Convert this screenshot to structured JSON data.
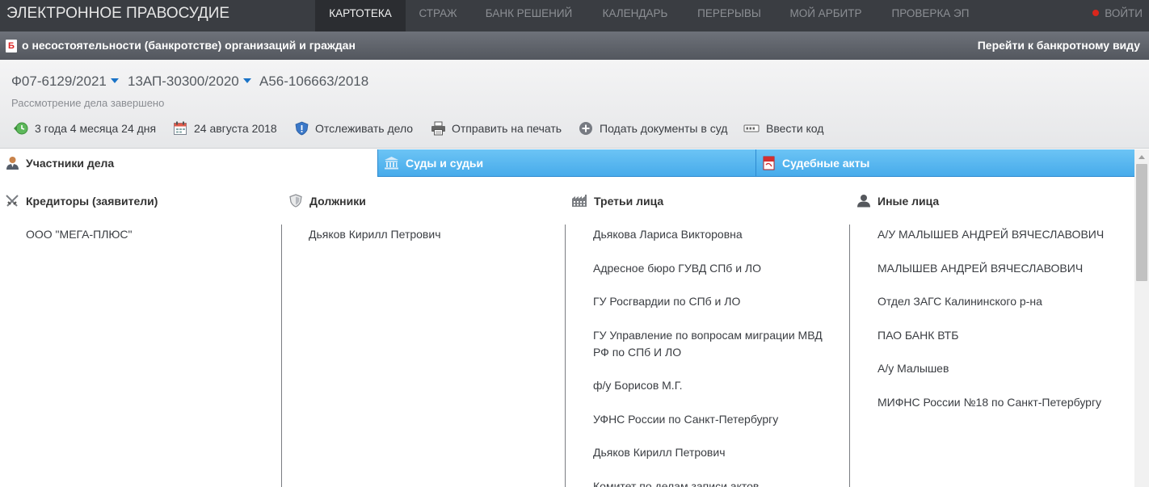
{
  "topnav": {
    "brand": "ЭЛЕКТРОННОЕ ПРАВОСУДИЕ",
    "items": [
      "КАРТОТЕКА",
      "СТРАЖ",
      "БАНК РЕШЕНИЙ",
      "КАЛЕНДАРЬ",
      "ПЕРЕРЫВЫ",
      "МОЙ АРБИТР",
      "ПРОВЕРКА ЭП"
    ],
    "active_item": "КАРТОТЕКА",
    "login": "ВОЙТИ"
  },
  "category_bar": {
    "icon": "bankruptcy-doc-icon",
    "title": "о несостоятельности (банкротстве) организаций и граждан",
    "switch_link": "Перейти к банкротному виду"
  },
  "case": {
    "numbers": [
      "Ф07-6129/2021",
      "13АП-30300/2020",
      "А56-106663/2018"
    ],
    "status": "Рассмотрение дела завершено",
    "actions": [
      {
        "icon": "clock-back-icon",
        "label": "3 года 4 месяца 24 дня"
      },
      {
        "icon": "calendar-icon",
        "label": "24 августа 2018"
      },
      {
        "icon": "shield-icon",
        "label": "Отслеживать дело"
      },
      {
        "icon": "printer-icon",
        "label": "Отправить на печать"
      },
      {
        "icon": "plus-circle-icon",
        "label": "Подать документы в суд"
      },
      {
        "icon": "code-input-icon",
        "label": "Ввести код"
      }
    ]
  },
  "tabs": [
    {
      "icon": "person-icon",
      "label": "Участники дела",
      "active": true
    },
    {
      "icon": "courthouse-icon",
      "label": "Суды и судьи",
      "active": false
    },
    {
      "icon": "pdf-icon",
      "label": "Судебные акты",
      "active": false
    }
  ],
  "columns": [
    {
      "icon": "crossed-swords-icon",
      "title": "Кредиторы (заявители)",
      "items": [
        "ООО \"МЕГА-ПЛЮС\""
      ]
    },
    {
      "icon": "shield-icon",
      "title": "Должники",
      "items": [
        "Дьяков Кирилл Петрович"
      ]
    },
    {
      "icon": "factory-icon",
      "title": "Третьи лица",
      "items": [
        "Дьякова Лариса Викторовна",
        "Адресное бюро ГУВД СПб и ЛО",
        "ГУ Росгвардии по СПб и ЛО",
        "ГУ Управление по вопросам миграции МВД РФ по СПб И ЛО",
        "ф/у Борисов М.Г.",
        "УФНС России по Санкт-Петербургу",
        "Дьяков Кирилл Петрович",
        "Комитет по делам записи актов"
      ]
    },
    {
      "icon": "person-icon",
      "title": "Иные лица",
      "items": [
        "А/У МАЛЫШЕВ АНДРЕЙ ВЯЧЕСЛАВОВИЧ",
        "МАЛЫШЕВ АНДРЕЙ ВЯЧЕСЛАВОВИЧ",
        "Отдел ЗАГС Калининского р-на",
        "ПАО БАНК ВТБ",
        "А/у Малышев",
        "МИФНС России №18 по Санкт-Петербургу"
      ]
    }
  ],
  "colors": {
    "nav_bg": "#3a3d42",
    "tab_blue": "#46aaea",
    "accent_blue": "#1a73c7",
    "login_dot": "#d9261c"
  }
}
